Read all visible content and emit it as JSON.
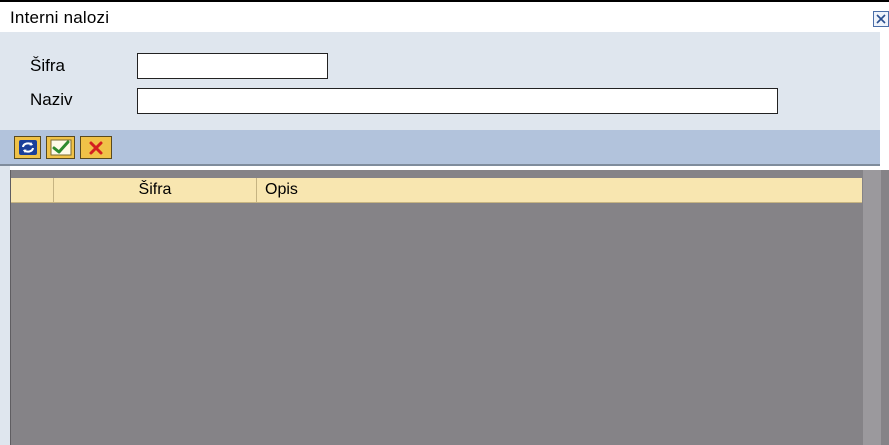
{
  "window": {
    "title": "Interni nalozi"
  },
  "form": {
    "sifra_label": "Šifra",
    "sifra_value": "",
    "naziv_label": "Naziv",
    "naziv_value": ""
  },
  "toolbar": {
    "buttons": [
      {
        "icon": "refresh-icon"
      },
      {
        "icon": "checkmark-icon"
      },
      {
        "icon": "cancel-x-icon"
      }
    ]
  },
  "table": {
    "columns": [
      "",
      "Šifra",
      "Opis"
    ],
    "rows": []
  },
  "colors": {
    "form_bg": "#dfe6ee",
    "toolbar_bg": "#b2c3dc",
    "button_bg": "#f0c248",
    "grid_bg": "#858387",
    "header_bg": "#f8e6b0"
  }
}
